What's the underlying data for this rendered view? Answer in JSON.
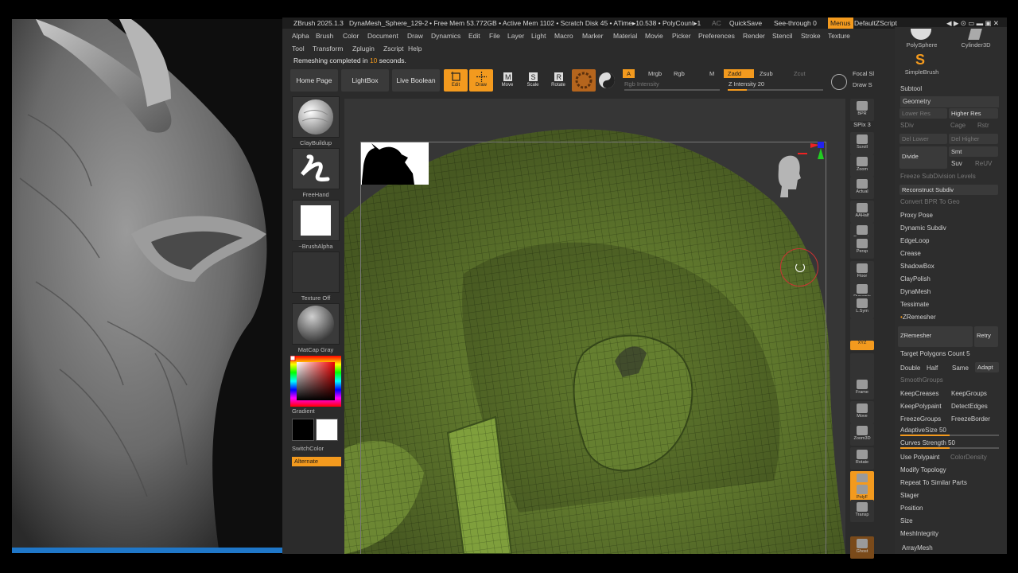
{
  "titlebar": {
    "app": "ZBrush 2025.1.3",
    "doc": "DynaMesh_Sphere_129-2",
    "stats": "• Free Mem 53.772GB • Active Mem 1102 • Scratch Disk 45 • ATime▸10.538 • PolyCount▸1",
    "ac": "AC",
    "quicksave": "QuickSave",
    "seethrough": "See-through",
    "seethrough_value": "0",
    "menus": "Menus",
    "script": "DefaultZScript"
  },
  "menu_row1": [
    "Alpha",
    "Brush",
    "Color",
    "Document",
    "Draw",
    "Dynamics",
    "Edit",
    "File",
    "Layer",
    "Light",
    "Macro",
    "Marker",
    "Material",
    "Movie",
    "Picker",
    "Preferences",
    "Render",
    "Stencil",
    "Stroke",
    "Texture"
  ],
  "menu_row2": [
    "Tool",
    "Transform",
    "Zplugin",
    "Zscript",
    "Help"
  ],
  "status": {
    "prefix": "Remeshing completed in",
    "value": "10",
    "suffix": "seconds."
  },
  "toolbar": {
    "home": "Home Page",
    "lightbox": "LightBox",
    "liveboolean": "Live Boolean",
    "modes": [
      "Edit",
      "Draw",
      "Move",
      "Scale",
      "Rotate"
    ],
    "a": "A",
    "mrgb": "Mrgb",
    "rgb": "Rgb",
    "m": "M",
    "rgb_intensity": "Rgb Intensity",
    "zadd": "Zadd",
    "zsub": "Zsub",
    "zcut": "Zcut",
    "z_intensity_label": "Z Intensity",
    "z_intensity_value": "20",
    "focal": "Focal Sl",
    "drawsize": "Draw S"
  },
  "tray": {
    "clay": "ClayBuildup",
    "freehand": "FreeHand",
    "alpha": "~BrushAlpha",
    "texture": "Texture Off",
    "matcap": "MatCap Gray",
    "gradient": "Gradient",
    "switchcolor": "SwitchColor",
    "alternate": "Alternate"
  },
  "shelf": [
    "BPR",
    "SPix 3",
    "Scroll",
    "Zoom",
    "Actual",
    "AAHalf",
    "Dynamic",
    "Persp",
    "Floor",
    "Dynamic",
    "L.Sym",
    "",
    "XYZ",
    "",
    "",
    "Frame",
    "Move",
    "Zoom3D",
    "Rotate",
    "Line Fill",
    "PolyF",
    "Transp",
    "Ghost"
  ],
  "palette": {
    "tools": [
      "PolySphere",
      "Cylinder3D",
      "SimpleBrush"
    ],
    "subtool": "Subtool",
    "geometry": "Geometry",
    "lower_res": "Lower Res",
    "higher_res": "Higher Res",
    "sdiv": "SDiv",
    "cage": "Cage",
    "rstr": "Rstr",
    "del_lower": "Del Lower",
    "del_higher": "Del Higher",
    "divide": "Divide",
    "smt": "Smt",
    "suv": "Suv",
    "reuv": "ReUV",
    "freeze": "Freeze SubDivision Levels",
    "reconstruct": "Reconstruct Subdiv",
    "convert": "Convert BPR To Geo",
    "list1": [
      "Proxy Pose",
      "Dynamic Subdiv",
      "EdgeLoop",
      "Crease",
      "ShadowBox",
      "ClayPolish",
      "DynaMesh",
      "Tessimate"
    ],
    "zremesher_hdr": "ZRemesher",
    "zremesher_btn": "ZRemesher",
    "retry": "Retry",
    "target_label": "Target Polygons Count",
    "target_value": "5",
    "double": "Double",
    "half": "Half",
    "same": "Same",
    "adapt": "Adapt",
    "smoothgroups": "SmoothGroups",
    "keepcreases": "KeepCreases",
    "keepgroups": "KeepGroups",
    "keeppolypaint": "KeepPolypaint",
    "detectedges": "DetectEdges",
    "freezegroups": "FreezeGroups",
    "freezeborder": "FreezeBorder",
    "adaptive_label": "AdaptiveSize",
    "adaptive_value": "50",
    "curves_label": "Curves Strength",
    "curves_value": "50",
    "usepolypaint": "Use Polypaint",
    "colordensity": "ColorDensity",
    "list2": [
      "Modify Topology",
      "Repeat To Similar Parts",
      "Stager",
      "Position",
      "Size",
      "MeshIntegrity"
    ],
    "arraymesh": "ArrayMesh"
  },
  "colors": {
    "accent": "#f39a1e",
    "mesh": "#7f9f3c",
    "bg": "#2b2b2b"
  },
  "progress": {
    "adaptive_fraction": 0.5,
    "curves_fraction": 0.5,
    "z_intensity_fraction": 0.2
  }
}
